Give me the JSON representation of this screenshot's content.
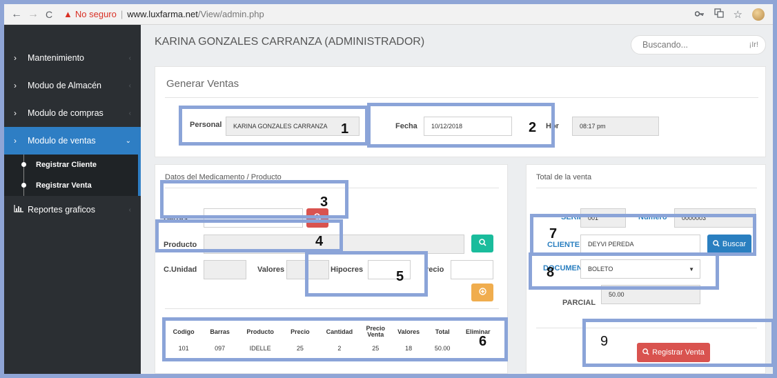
{
  "browser": {
    "back": "←",
    "forward": "→",
    "reload": "C",
    "warning": "▲",
    "insecure": "No seguro",
    "separator": "|",
    "host": "www.luxfarma.net",
    "path": "/View/admin.php",
    "key_icon": "key-icon",
    "translate_icon": "translate-icon",
    "star": "☆"
  },
  "sidebar": {
    "items": [
      {
        "label": "Mantenimiento"
      },
      {
        "label": "Moduo de Almacén"
      },
      {
        "label": "Modulo de compras"
      },
      {
        "label": "Modulo de ventas"
      }
    ],
    "subitems": [
      {
        "label": "Registrar Cliente"
      },
      {
        "label": "Registrar Venta"
      }
    ],
    "reports": {
      "label": "Reportes graficos"
    }
  },
  "header": {
    "user": "KARINA GONZALES CARRANZA (ADMINISTRADOR)",
    "search_placeholder": "Buscando...",
    "search_go": "¡Ir!"
  },
  "generar": {
    "title": "Generar Ventas",
    "personal_label": "Personal",
    "personal_value": "KARINA GONZALES CARRANZA",
    "fecha_label": "Fecha",
    "fecha_value": "10/12/2018",
    "hora_label": "Hor",
    "hora_value": "08:17 pm"
  },
  "producto": {
    "title": "Datos del Medicamento / Producto",
    "barras_label": "Barras",
    "producto_label": "Producto",
    "cunidad_label": "C.Unidad",
    "valores_label": "Valores",
    "hipocres_label": "Hipocres",
    "precio_label": "recio"
  },
  "table": {
    "headers": [
      "Codigo",
      "Barras",
      "Producto",
      "Precio",
      "Cantidad",
      "Precio Venta",
      "Valores",
      "Total",
      "Eliminar"
    ],
    "rows": [
      [
        "101",
        "097",
        "IDELLE",
        "25",
        "2",
        "25",
        "18",
        "50.00",
        ""
      ]
    ]
  },
  "total": {
    "title": "Total de la venta",
    "serie_label": "SERIE",
    "serie_value": "001",
    "numero_label": "Numero",
    "numero_value": "0000003",
    "cliente_label": "CLIENTE",
    "cliente_value": "DEYVI PEREDA",
    "buscar_label": "Buscar",
    "documento_label": "DOCUMEN",
    "documento_value": "BOLETO",
    "parcial_label": "PARCIAL",
    "parcial_value": "50.00",
    "registrar_label": "Registrar Venta"
  },
  "annotations": [
    "1",
    "2",
    "3",
    "4",
    "5",
    "6",
    "7",
    "8",
    "9"
  ],
  "colors": {
    "sidebar_bg": "#2b2f33",
    "active_blue": "#2e7ec4",
    "annotation": "#8ba4d8",
    "red": "#d9534f",
    "green": "#1abc9c",
    "orange": "#f0ad4e"
  }
}
